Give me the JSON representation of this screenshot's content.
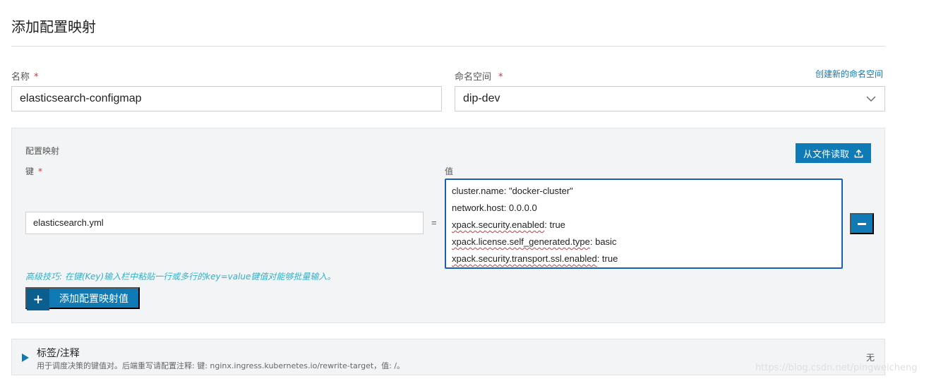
{
  "page": {
    "title": "添加配置映射"
  },
  "form": {
    "name_label": "名称",
    "required_mark": "*",
    "name_value": "elasticsearch-configmap",
    "namespace_label": "命名空间",
    "namespace_value": "dip-dev",
    "create_namespace_link": "创建新的命名空间"
  },
  "configmap": {
    "section_label": "配置映射",
    "read_from_file_label": "从文件读取",
    "key_label": "键",
    "value_label": "值",
    "equals_sign": "=",
    "entries": [
      {
        "key": "elasticsearch.yml",
        "value_lines": [
          "cluster.name: \"docker-cluster\"",
          "network.host: 0.0.0.0",
          "xpack.security.enabled: true",
          "xpack.license.self_generated.type: basic",
          "xpack.security.transport.ssl.enabled: true"
        ],
        "spellcheck_marked": [
          "xpack.security.enabled",
          "xpack.license.self_generated.type",
          "xpack.security.transport.ssl.enabled"
        ],
        "unmarked_tails": [
          ": true",
          ": basic",
          ": true"
        ]
      }
    ],
    "hint": "高级技巧: 在键(Key)输入栏中粘贴一行或多行的key=value键值对能够批量输入。",
    "add_button_label": "添加配置映射值",
    "add_button_icon": "+"
  },
  "labels_section": {
    "title": "标签/注释",
    "description": "用于调度决策的键值对。后端重写请配置注释: 键: nginx.ingress.kubernetes.io/rewrite-target，值: /。",
    "value": "无"
  },
  "watermark": "https://blog.csdn.net/pingweicheng",
  "colors": {
    "primary": "#0f7ab5",
    "focus_border": "#1a5fb4",
    "required": "#d6323a",
    "hint": "#2fb1c8",
    "panel_bg": "#f3f4f5"
  }
}
